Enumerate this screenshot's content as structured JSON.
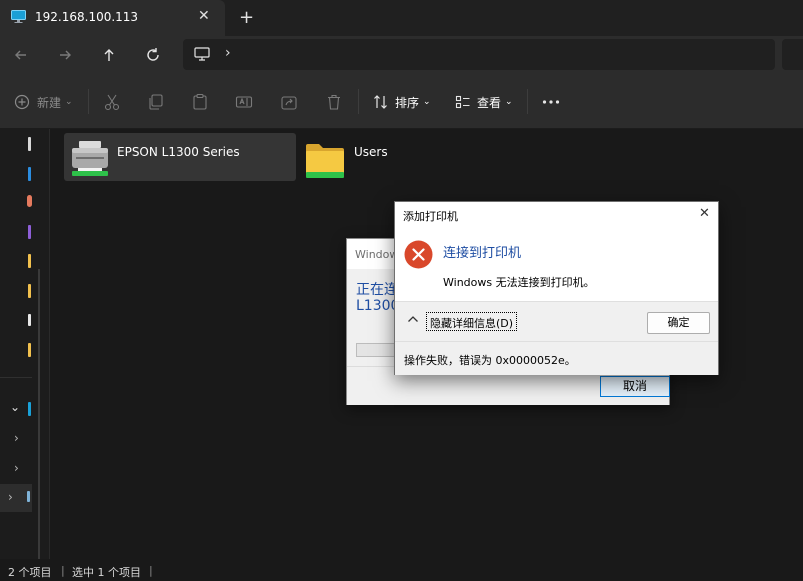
{
  "tabs": [
    {
      "title": "192.168.100.113",
      "icon": "monitor-icon",
      "active": true
    }
  ],
  "toolbar": {
    "new_label": "新建",
    "sort_label": "排序",
    "view_label": "查看"
  },
  "items": [
    {
      "name": "EPSON L1300 Series",
      "icon": "printer-icon",
      "selected": true
    },
    {
      "name": "Users",
      "icon": "folder-icon",
      "selected": false
    }
  ],
  "status": {
    "count": "2 个项目",
    "selected": "选中 1 个项目"
  },
  "progress_dialog": {
    "title": "Window",
    "line1": "正在连",
    "line2": "L1300",
    "cancel_label": "取消"
  },
  "error_dialog": {
    "title": "添加打印机",
    "heading": "连接到打印机",
    "message": "Windows 无法连接到打印机。",
    "details_label": "隐藏详细信息(D)",
    "ok_label": "确定",
    "detail_text": "操作失败，错误为 0x0000052e。"
  },
  "colors": {
    "accent": "#1f4ea3",
    "error_red": "#d9482b",
    "background": "#191919",
    "toolbar": "#2c2c2c"
  }
}
